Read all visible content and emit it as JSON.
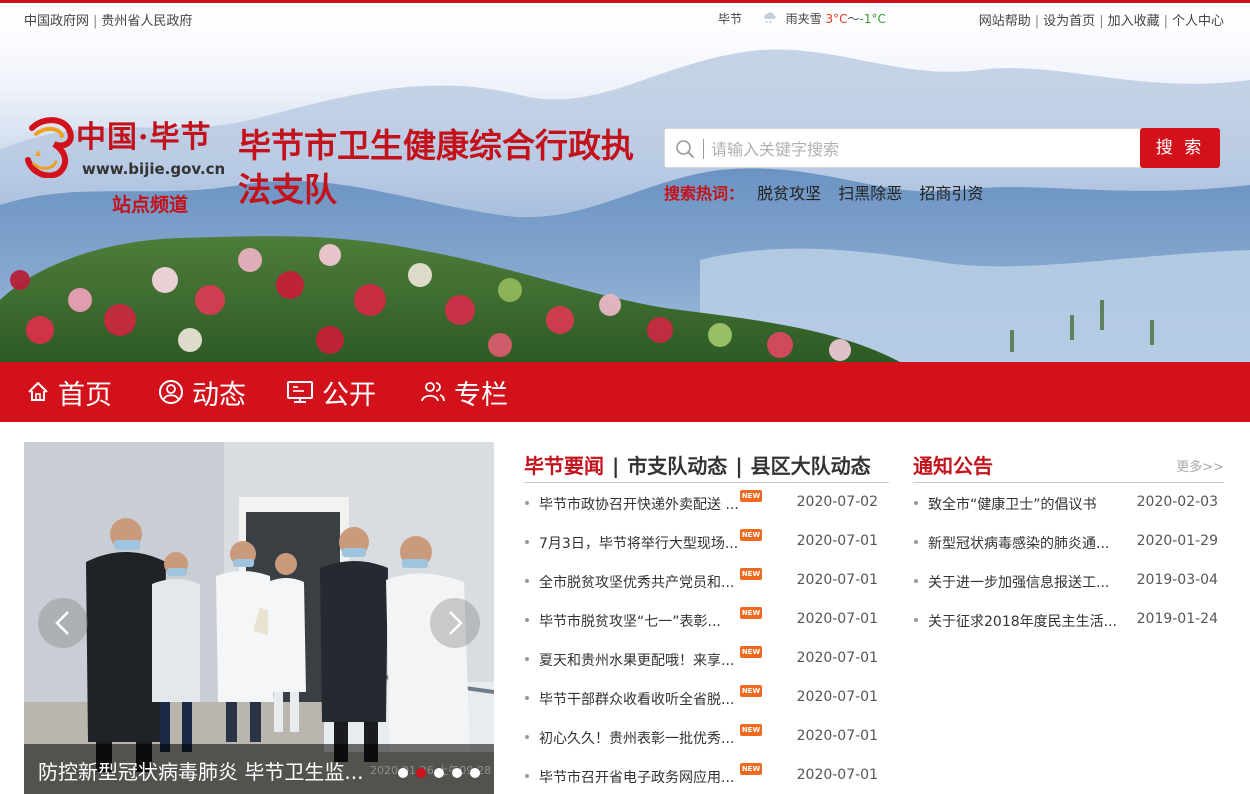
{
  "colors": {
    "brand_red": "#d2111b",
    "title_red": "#c4121c",
    "new_tag": "#ef6a1f"
  },
  "topbar": {
    "links_left": [
      "中国政府网",
      "贵州省人民政府"
    ],
    "weather": {
      "city": "毕节",
      "condition": "雨夹雪",
      "temp_high": "3°C",
      "temp_sep": "～",
      "temp_low": "-1°C",
      "icon": "sleet-icon"
    },
    "links_right": [
      "网站帮助",
      "设为首页",
      "加入收藏",
      "个人中心"
    ]
  },
  "logo": {
    "name": "中国·毕节",
    "url": "www.bijie.gov.cn",
    "subtitle": "站点频道"
  },
  "site_title": "毕节市卫生健康综合行政执法支队",
  "search": {
    "placeholder": "请输入关键字搜索",
    "button": "搜 索",
    "hot_label": "搜索热词：",
    "hot_words": [
      "脱贫攻坚",
      "扫黑除恶",
      "招商引资"
    ]
  },
  "nav": {
    "items": [
      {
        "label": "首页",
        "icon": "home-icon"
      },
      {
        "label": "动态",
        "icon": "user-circle-icon"
      },
      {
        "label": "公开",
        "icon": "monitor-icon"
      },
      {
        "label": "专栏",
        "icon": "people-icon"
      }
    ]
  },
  "slider": {
    "caption": "防控新型冠状病毒肺炎 毕节卫生监...",
    "date": "2020-01-26 上午09:28",
    "dot_count": 5,
    "active_dot": 2
  },
  "news": {
    "tabs": [
      "毕节要闻",
      "市支队动态",
      "县区大队动态"
    ],
    "active_tab": 0,
    "new_label": "NEW",
    "items": [
      {
        "title": "毕节市政协召开快递外卖配送 ...",
        "date": "2020-07-02"
      },
      {
        "title": "7月3日，毕节将举行大型现场...",
        "date": "2020-07-01"
      },
      {
        "title": "全市脱贫攻坚优秀共产党员和...",
        "date": "2020-07-01"
      },
      {
        "title": "毕节市脱贫攻坚“七一”表彰...",
        "date": "2020-07-01"
      },
      {
        "title": "夏天和贵州水果更配哦！来享...",
        "date": "2020-07-01"
      },
      {
        "title": "毕节干部群众收看收听全省脱...",
        "date": "2020-07-01"
      },
      {
        "title": "初心久久！贵州表彰一批优秀...",
        "date": "2020-07-01"
      },
      {
        "title": "毕节市召开省电子政务网应用...",
        "date": "2020-07-01"
      }
    ]
  },
  "notice": {
    "title": "通知公告",
    "more": "更多>>",
    "items": [
      {
        "title": "致全市“健康卫士”的倡议书",
        "date": "2020-02-03"
      },
      {
        "title": "新型冠状病毒感染的肺炎通...",
        "date": "2020-01-29"
      },
      {
        "title": "关于进一步加强信息报送工...",
        "date": "2019-03-04"
      },
      {
        "title": "关于征求2018年度民主生活...",
        "date": "2019-01-24"
      }
    ]
  }
}
